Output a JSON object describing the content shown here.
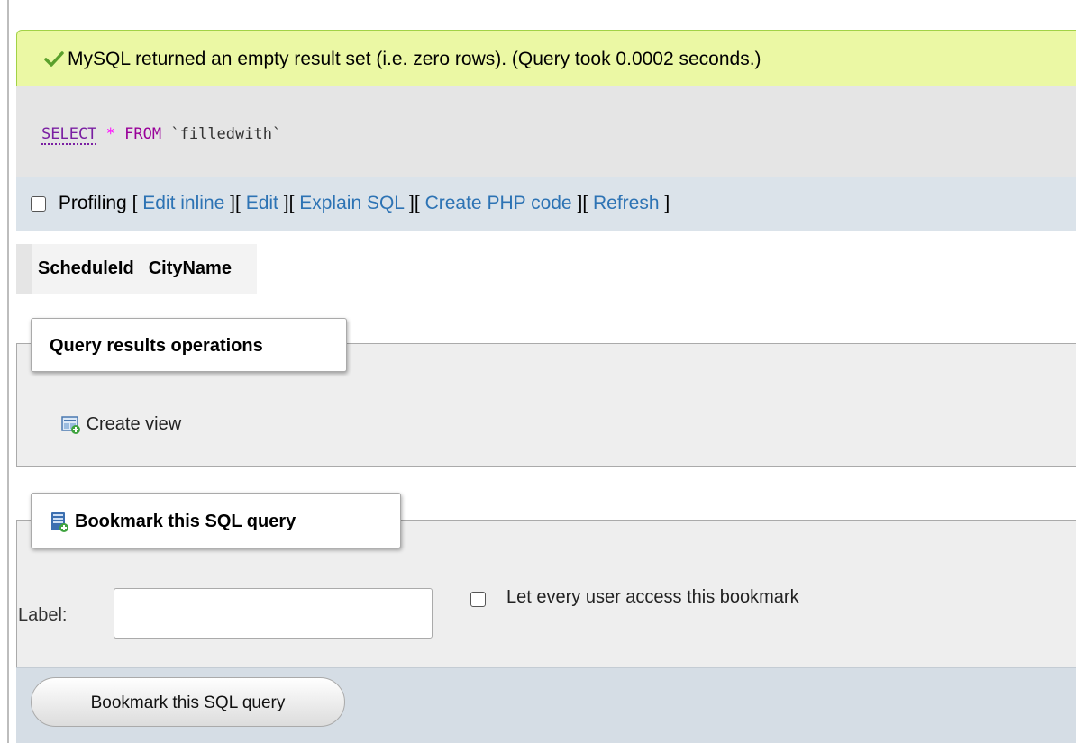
{
  "message": {
    "icon": "check-icon",
    "text": "MySQL returned an empty result set (i.e. zero rows). (Query took 0.0002 seconds.)"
  },
  "sql": {
    "select": "SELECT",
    "star": "*",
    "from": "FROM",
    "table": "`filledwith`"
  },
  "toolbar": {
    "profiling": "Profiling",
    "open": "[",
    "close": "]",
    "links": [
      "Edit inline",
      "Edit",
      "Explain SQL",
      "Create PHP code",
      "Refresh"
    ]
  },
  "results": {
    "columns": [
      "ScheduleId",
      "CityName"
    ]
  },
  "operations": {
    "title": "Query results operations",
    "create_view": "Create view",
    "create_view_icon": "create-view-icon"
  },
  "bookmark": {
    "title": "Bookmark this SQL query",
    "title_icon": "bookmark-icon",
    "label_text": "Label:",
    "label_value": "",
    "share_text": "Let every user access this bookmark",
    "button": "Bookmark this SQL query"
  }
}
